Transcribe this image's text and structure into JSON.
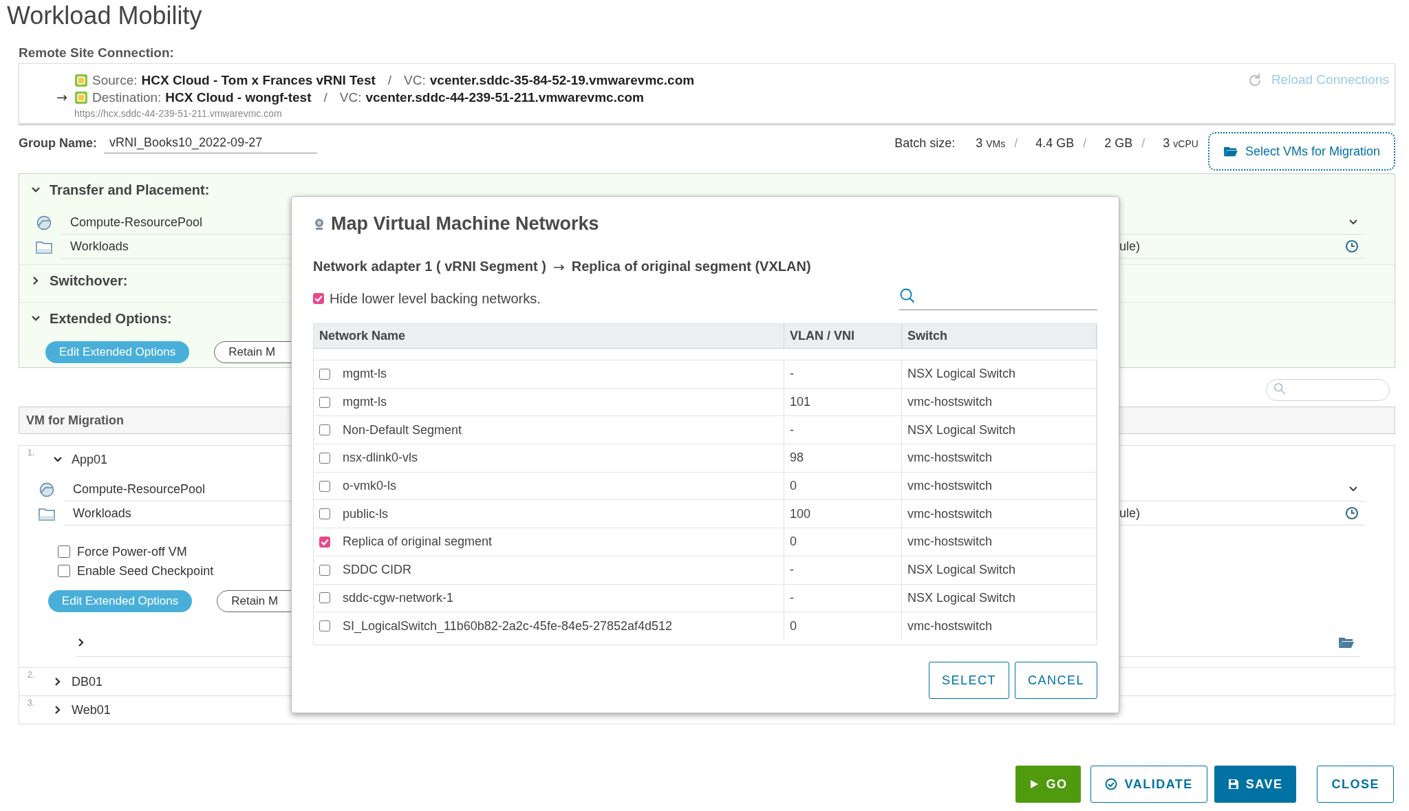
{
  "page": {
    "title": "Workload Mobility"
  },
  "connection": {
    "heading": "Remote Site Connection:",
    "source": {
      "label": "Source:",
      "name": "HCX Cloud - Tom x Frances vRNI Test",
      "separator": "/",
      "vc_label": "VC:",
      "vc": "vcenter.sddc-35-84-52-19.vmwarevmc.com"
    },
    "destination": {
      "prefix": "→",
      "label": "Destination:",
      "name": "HCX Cloud - wongf-test",
      "separator": "/",
      "vc_label": "VC:",
      "vc": "vcenter.sddc-44-239-51-211.vmwarevmc.com"
    },
    "url": "https://hcx.sddc-44-239-51-211.vmwarevmc.com",
    "reload": "Reload Connections"
  },
  "group": {
    "label": "Group Name:",
    "value": "vRNI_Books10_2022-09-27"
  },
  "batch": {
    "label": "Batch size:",
    "items": [
      {
        "value": "3",
        "unit": "VMs",
        "separator": "/"
      },
      {
        "value": "4.4 GB",
        "separator": "/"
      },
      {
        "value": "2 GB",
        "separator": "/"
      },
      {
        "value": "3",
        "unit": "vCPU"
      }
    ]
  },
  "select_vms_button": "Select VMs for Migration",
  "placement": {
    "sections": [
      {
        "title": "Transfer and Placement:",
        "expanded": true,
        "rows": [
          {
            "kind": "pool",
            "label": "Compute-ResourcePool"
          },
          {
            "kind": "folder",
            "label": "Workloads",
            "tail": "ule)"
          }
        ]
      },
      {
        "title": "Switchover:",
        "expanded": false
      },
      {
        "title": "Extended Options:",
        "expanded": true,
        "buttons": [
          {
            "kind": "primary",
            "label": "Edit Extended Options"
          },
          {
            "kind": "outline",
            "label": "Retain M"
          }
        ]
      }
    ]
  },
  "vm_table": {
    "heading": "VM for Migration",
    "items": [
      {
        "number": "1.",
        "name": "App01",
        "expanded": true,
        "rows": [
          {
            "kind": "pool",
            "label": "Compute-ResourcePool"
          },
          {
            "kind": "folder",
            "label": "Workloads",
            "tail": "ule)"
          }
        ],
        "options": [
          {
            "label": "Force Power-off VM",
            "checked": false
          },
          {
            "label": "Enable Seed Checkpoint",
            "checked": false
          }
        ],
        "buttons": [
          {
            "kind": "primary",
            "label": "Edit Extended Options"
          },
          {
            "kind": "outline",
            "label": "Retain M"
          }
        ]
      },
      {
        "number": "2.",
        "name": "DB01",
        "expanded": false
      },
      {
        "number": "3.",
        "name": "Web01",
        "expanded": false
      }
    ]
  },
  "modal": {
    "title": "Map Virtual Machine Networks",
    "mapping": {
      "source": "Network adapter 1 ( vRNI Segment )",
      "arrow": "→",
      "target": "Replica of original segment (VXLAN)"
    },
    "hide_lower": {
      "label": "Hide lower level backing networks.",
      "checked": true
    },
    "columns": [
      "Network Name",
      "VLAN / VNI",
      "Switch"
    ],
    "rows": [
      {
        "name": "mgmt-ls",
        "vlan": "-",
        "switch": "NSX Logical Switch",
        "selected": false
      },
      {
        "name": "mgmt-ls",
        "vlan": "101",
        "switch": "vmc-hostswitch",
        "selected": false
      },
      {
        "name": "Non-Default Segment",
        "vlan": "-",
        "switch": "NSX Logical Switch",
        "selected": false
      },
      {
        "name": "nsx-dlink0-vls",
        "vlan": "98",
        "switch": "vmc-hostswitch",
        "selected": false
      },
      {
        "name": "o-vmk0-ls",
        "vlan": "0",
        "switch": "vmc-hostswitch",
        "selected": false
      },
      {
        "name": "public-ls",
        "vlan": "100",
        "switch": "vmc-hostswitch",
        "selected": false
      },
      {
        "name": "Replica of original segment",
        "vlan": "0",
        "switch": "vmc-hostswitch",
        "selected": true
      },
      {
        "name": "SDDC CIDR",
        "vlan": "-",
        "switch": "NSX Logical Switch",
        "selected": false
      },
      {
        "name": "sddc-cgw-network-1",
        "vlan": "-",
        "switch": "NSX Logical Switch",
        "selected": false
      },
      {
        "name": "SI_LogicalSwitch_11b60b82-2a2c-45fe-84e5-27852af4d512",
        "vlan": "0",
        "switch": "vmc-hostswitch",
        "selected": false
      }
    ],
    "buttons": [
      "SELECT",
      "CANCEL"
    ]
  },
  "footer": {
    "buttons": [
      {
        "kind": "go",
        "label": "GO"
      },
      {
        "kind": "validate",
        "label": "VALIDATE"
      },
      {
        "kind": "save",
        "label": "SAVE"
      },
      {
        "kind": "close",
        "label": "CLOSE"
      }
    ]
  }
}
